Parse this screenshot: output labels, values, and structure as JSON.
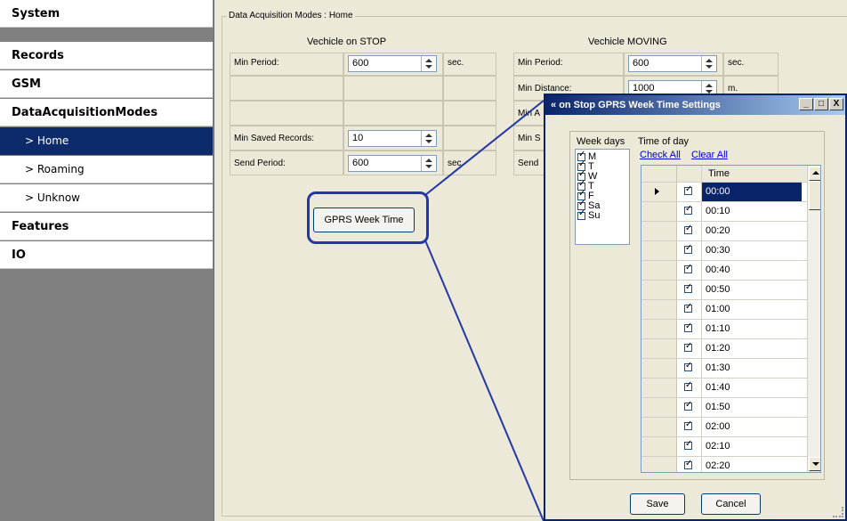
{
  "sidebar": {
    "items": [
      {
        "label": "System"
      },
      {
        "label": "Records"
      },
      {
        "label": "GSM"
      },
      {
        "label": "DataAcquisitionModes"
      },
      {
        "label": "> Home"
      },
      {
        "label": "> Roaming"
      },
      {
        "label": "> Unknow"
      },
      {
        "label": "Features"
      },
      {
        "label": "IO"
      }
    ]
  },
  "main": {
    "group_title": "Data Acquisition Modes : Home",
    "stop": {
      "title": "Vechicle on STOP",
      "min_period_label": "Min Period:",
      "min_period_value": "600",
      "min_period_unit": "sec.",
      "min_saved_label": "Min Saved Records:",
      "min_saved_value": "10",
      "send_period_label": "Send Period:",
      "send_period_value": "600",
      "send_period_unit": "sec."
    },
    "moving": {
      "title": "Vechicle MOVING",
      "min_period_label": "Min Period:",
      "min_period_value": "600",
      "min_period_unit": "sec.",
      "min_distance_label": "Min Distance:",
      "min_distance_value": "1000",
      "min_distance_unit": "m.",
      "min_angle_label": "Min A",
      "min_saved_label": "Min S",
      "send_label": "Send"
    },
    "gprs_button": "GPRS Week Time"
  },
  "dialog": {
    "title": "on Stop GPRS Week Time Settings",
    "minimize": "_",
    "maximize": "□",
    "close": "X",
    "week_days_title": "Week days",
    "week_days": [
      "M",
      "T",
      "W",
      "T",
      "F",
      "Sa",
      "Su"
    ],
    "time_of_day_title": "Time of day",
    "check_all": "Check All",
    "clear_all": "Clear All",
    "time_header": "Time",
    "times": [
      "00:00",
      "00:10",
      "00:20",
      "00:30",
      "00:40",
      "00:50",
      "01:00",
      "01:10",
      "01:20",
      "01:30",
      "01:40",
      "01:50",
      "02:00",
      "02:10",
      "02:20"
    ],
    "save": "Save",
    "cancel": "Cancel"
  }
}
